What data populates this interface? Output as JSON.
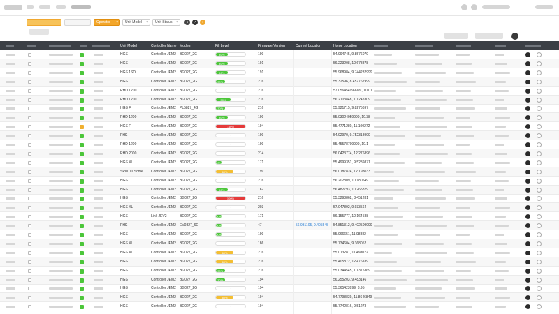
{
  "filters": {
    "status_filter_label": "Operator",
    "unit_model_label": "Unit Model",
    "unit_status_label": "Unit Status"
  },
  "table": {
    "headers": {
      "unit_model": "Unit Model",
      "controller_name": "Controller Name",
      "modem": "Modem",
      "fill_level": "Fill Level",
      "firmware_version": "Firmware Version",
      "current_location": "Current Location",
      "home_location": "Home Location"
    },
    "rows": [
      {
        "status_color": "#4cc63a",
        "unit_model": "HGS",
        "controller": "Controller JEM2",
        "modem": "BG027_2G",
        "fill": 40,
        "fill_color": "#4cc63a",
        "firmware": "199",
        "current": "",
        "home": "54.994745, 9.8576079"
      },
      {
        "status_color": "#4cc63a",
        "unit_model": "HGS",
        "controller": "Controller JEM2",
        "modem": "BG027_2G",
        "fill": 40,
        "fill_color": "#4cc63a",
        "firmware": "191",
        "current": "",
        "home": "56.223208, 10.678878"
      },
      {
        "status_color": "#4cc63a",
        "unit_model": "HGS 1SD",
        "controller": "Controller JEM2",
        "modem": "BG027_2G",
        "fill": 40,
        "fill_color": "#4cc63a",
        "firmware": "191",
        "current": "",
        "home": "55.968984, 9.744232999"
      },
      {
        "status_color": "#4cc63a",
        "unit_model": "HGS",
        "controller": "Controller JEM2",
        "modem": "BG027_2G",
        "fill": 30,
        "fill_color": "#4cc63a",
        "firmware": "216",
        "current": "",
        "home": "55.32596, 8.457767999"
      },
      {
        "status_color": "#4cc63a",
        "unit_model": "RHD 1200",
        "controller": "Controller JEM2",
        "modem": "BG027_2G",
        "fill": null,
        "fill_color": "",
        "firmware": "216",
        "current": "",
        "home": "57.056454999999, 10.01"
      },
      {
        "status_color": "#4cc63a",
        "unit_model": "RHD 1200",
        "controller": "Controller JEM2",
        "modem": "BG027_2G",
        "fill": 50,
        "fill_color": "#4cc63a",
        "firmware": "216",
        "current": "",
        "home": "56.2103848, 10.247809"
      },
      {
        "status_color": "#4cc63a",
        "unit_model": "HGS F",
        "controller": "Controller JEM2",
        "modem": "PL5827_4G",
        "fill": 30,
        "fill_color": "#4cc63a",
        "firmware": "216",
        "current": "",
        "home": "55.921715, 9.8275697"
      },
      {
        "status_color": "#4cc63a",
        "unit_model": "RHD 1200",
        "controller": "Controller JEM2",
        "modem": "BG027_2G",
        "fill": 40,
        "fill_color": "#4cc63a",
        "firmware": "199",
        "current": "",
        "home": "55.03024059999, 10.38"
      },
      {
        "status_color": "#f0b030",
        "unit_model": "HGS F",
        "controller": "Controller JEM2",
        "modem": "BG027_2G",
        "fill": 110,
        "fill_color": "#e53a3a",
        "firmware": "194",
        "current": "",
        "home": "55.4771280, 11.100272"
      },
      {
        "status_color": "#4cc63a",
        "unit_model": "PHK",
        "controller": "Controller JEM2",
        "modem": "BG027_2G",
        "fill": null,
        "fill_color": "",
        "firmware": "199",
        "current": "",
        "home": "54.92970, 9.752318999"
      },
      {
        "status_color": "#4cc63a",
        "unit_model": "RHD 1200",
        "controller": "Controller JEM2",
        "modem": "BG027_2G",
        "fill": null,
        "fill_color": "",
        "firmware": "199",
        "current": "",
        "home": "55.45578799999, 10.1"
      },
      {
        "status_color": "#4cc63a",
        "unit_model": "RHD 2000",
        "controller": "Controller JEM2",
        "modem": "BG027_2G",
        "fill": null,
        "fill_color": "",
        "firmware": "214",
        "current": "",
        "home": "56.0423774, 12.276896"
      },
      {
        "status_color": "#4cc63a",
        "unit_model": "HGS XL",
        "controller": "Controller JEM2",
        "modem": "BG027_2G",
        "fill": 20,
        "fill_color": "#4cc63a",
        "firmware": "171",
        "current": "",
        "home": "55.4999351, 9.5289871"
      },
      {
        "status_color": "#4cc63a",
        "unit_model": "SPW 10 Some",
        "controller": "Controller JEM2",
        "modem": "BG027_2G",
        "fill": 60,
        "fill_color": "#f3be33",
        "firmware": "199",
        "current": "",
        "home": "56.0187824, 12.198033"
      },
      {
        "status_color": "#4cc63a",
        "unit_model": "HGS",
        "controller": "Controller JEM2",
        "modem": "BG027_2G",
        "fill": null,
        "fill_color": "",
        "firmware": "216",
        "current": "",
        "home": "56.202809, 10.180549"
      },
      {
        "status_color": "#4cc63a",
        "unit_model": "HGS",
        "controller": "Controller JEM2",
        "modem": "BG027_2G",
        "fill": 40,
        "fill_color": "#4cc63a",
        "firmware": "162",
        "current": "",
        "home": "56.482793, 10.265829"
      },
      {
        "status_color": "#4cc63a",
        "unit_model": "HGS",
        "controller": "Controller JEM2",
        "modem": "BG027_2G",
        "fill": 100,
        "fill_color": "#e53a3a",
        "firmware": "216",
        "current": "",
        "home": "55.3298862, 8.451281"
      },
      {
        "status_color": "#4cc63a",
        "unit_model": "HGS XL",
        "controller": "Controller JEM2",
        "modem": "BG027_2G",
        "fill": null,
        "fill_color": "",
        "firmware": "203",
        "current": "",
        "home": "57.047892, 9.933564"
      },
      {
        "status_color": "#4cc63a",
        "unit_model": "HGS",
        "controller": "Link JEV2",
        "modem": "BG027_2G",
        "fill": 20,
        "fill_color": "#4cc63a",
        "firmware": "171",
        "current": "",
        "home": "56.155777, 10.164588"
      },
      {
        "status_color": "#4cc63a",
        "unit_model": "PHK",
        "controller": "Controller JEM2",
        "modem": "EV0827_6G",
        "fill": 20,
        "fill_color": "#4cc63a",
        "firmware": "47",
        "current": "56.931105, 9.405545",
        "home": "54.851312, 9.402509999"
      },
      {
        "status_color": "#4cc63a",
        "unit_model": "HGS",
        "controller": "Controller JEM2",
        "modem": "BG027_2G",
        "fill": 20,
        "fill_color": "#4cc63a",
        "firmware": "199",
        "current": "",
        "home": "55.966651, 11.98882"
      },
      {
        "status_color": "#4cc63a",
        "unit_model": "HGS XL",
        "controller": "Controller JEM2",
        "modem": "BG027_2G",
        "fill": null,
        "fill_color": "",
        "firmware": "186",
        "current": "",
        "home": "55.734604, 9.368052"
      },
      {
        "status_color": "#4cc63a",
        "unit_model": "HGS XL",
        "controller": "Controller JEM2",
        "modem": "BG027_2G",
        "fill": 60,
        "fill_color": "#f3be33",
        "firmware": "216",
        "current": "",
        "home": "55.013281, 11.498022"
      },
      {
        "status_color": "#4cc63a",
        "unit_model": "HGS",
        "controller": "Controller JEM2",
        "modem": "BG027_2G",
        "fill": 60,
        "fill_color": "#f3be33",
        "firmware": "216",
        "current": "",
        "home": "55.405872, 12.476189"
      },
      {
        "status_color": "#4cc63a",
        "unit_model": "HGS",
        "controller": "Controller JEM2",
        "modem": "BG027_2G",
        "fill": 30,
        "fill_color": "#4cc63a",
        "firmware": "216",
        "current": "",
        "home": "55.0344545, 10.375369"
      },
      {
        "status_color": "#4cc63a",
        "unit_model": "HGS",
        "controller": "Controller JEM2",
        "modem": "BG027_2G",
        "fill": 30,
        "fill_color": "#4cc63a",
        "firmware": "194",
        "current": "",
        "home": "56.255203, 9.483146"
      },
      {
        "status_color": "#4cc63a",
        "unit_model": "HGS",
        "controller": "Controller JEM2",
        "modem": "BG027_2G",
        "fill": null,
        "fill_color": "",
        "firmware": "194",
        "current": "",
        "home": "55.365423999, 8.95"
      },
      {
        "status_color": "#4cc63a",
        "unit_model": "HGS",
        "controller": "Controller JEM2",
        "modem": "BG027_2G",
        "fill": 60,
        "fill_color": "#f3be33",
        "firmware": "194",
        "current": "",
        "home": "54.7798839, 11.8646849"
      },
      {
        "status_color": "#4cc63a",
        "unit_model": "HGS",
        "controller": "Controller JEM2",
        "modem": "BG027_2G",
        "fill": null,
        "fill_color": "",
        "firmware": "194",
        "current": "",
        "home": "55.7742816, 9.51273"
      }
    ]
  }
}
